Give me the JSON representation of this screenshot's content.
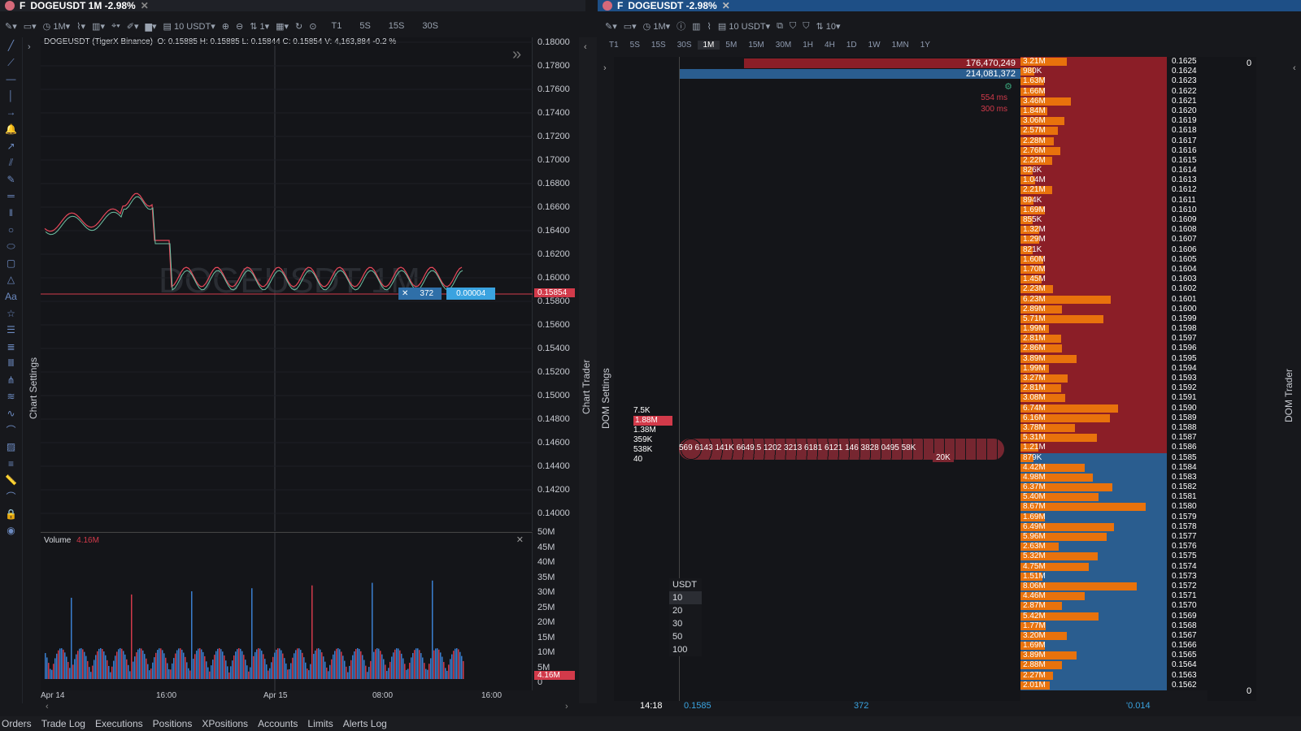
{
  "left_tab": {
    "title": "DOGEUSDT 1M -2.98%",
    "prefix": "F"
  },
  "right_tab": {
    "title": "DOGEUSDT -2.98%",
    "prefix": "F"
  },
  "chart_toolbar": {
    "interval": "1M",
    "size": "10 USDT",
    "tf": [
      "T1",
      "5S",
      "15S",
      "30S"
    ]
  },
  "chart_info": {
    "symbol": "DOGEUSDT (TigerX Binance)",
    "ohlc": "O: 0.15885 H: 0.15885 L: 0.15844 C: 0.15854 V: 4,163,884 -0.2 %"
  },
  "watermark": "DOGEUSDT 1M",
  "price_axis": [
    "0.18000",
    "0.17800",
    "0.17600",
    "0.17400",
    "0.17200",
    "0.17000",
    "0.16800",
    "0.16600",
    "0.16400",
    "0.16200",
    "0.16000",
    "0.15800",
    "0.15600",
    "0.15400",
    "0.15200",
    "0.15000",
    "0.14800",
    "0.14600",
    "0.14400",
    "0.14200",
    "0.14000"
  ],
  "last_price": "0.15854",
  "order_marker": {
    "qty": "372",
    "offset": "0.00004"
  },
  "volume_panel": {
    "title": "Volume",
    "value": "4.16M",
    "axis": [
      "50M",
      "45M",
      "40M",
      "35M",
      "30M",
      "25M",
      "20M",
      "15M",
      "10M",
      "5M",
      "0"
    ],
    "current": "4.16M"
  },
  "time_axis": [
    "Apr 14",
    "16:00",
    "Apr 15",
    "08:00",
    "16:00"
  ],
  "side_labels": {
    "chart_settings": "Chart Settings",
    "chart_trader": "Chart Trader",
    "dom_settings": "DOM Settings",
    "dom_trader": "DOM Trader"
  },
  "dom_toolbar": {
    "interval": "1M",
    "size": "10 USDT",
    "levels": "10"
  },
  "dom_timeframes": [
    "T1",
    "5S",
    "15S",
    "30S",
    "1M",
    "5M",
    "15M",
    "30M",
    "1H",
    "4H",
    "1D",
    "1W",
    "1MN",
    "1Y"
  ],
  "dom_totals": {
    "ask_total": "176,470,249",
    "bid_total": "214,081,372",
    "latency1": "554 ms",
    "latency2": "300 ms"
  },
  "dom_asks": [
    [
      "3.21M",
      "0.1625"
    ],
    [
      "980K",
      "0.1624"
    ],
    [
      "1.63M",
      "0.1623"
    ],
    [
      "1.66M",
      "0.1622"
    ],
    [
      "3.46M",
      "0.1621"
    ],
    [
      "1.84M",
      "0.1620"
    ],
    [
      "3.06M",
      "0.1619"
    ],
    [
      "2.57M",
      "0.1618"
    ],
    [
      "2.28M",
      "0.1617"
    ],
    [
      "2.76M",
      "0.1616"
    ],
    [
      "2.22M",
      "0.1615"
    ],
    [
      "826K",
      "0.1614"
    ],
    [
      "1.04M",
      "0.1613"
    ],
    [
      "2.21M",
      "0.1612"
    ],
    [
      "894K",
      "0.1611"
    ],
    [
      "1.69M",
      "0.1610"
    ],
    [
      "855K",
      "0.1609"
    ],
    [
      "1.32M",
      "0.1608"
    ],
    [
      "1.29M",
      "0.1607"
    ],
    [
      "821K",
      "0.1606"
    ],
    [
      "1.60M",
      "0.1605"
    ],
    [
      "1.70M",
      "0.1604"
    ],
    [
      "1.45M",
      "0.1603"
    ],
    [
      "2.23M",
      "0.1602"
    ],
    [
      "6.23M",
      "0.1601"
    ],
    [
      "2.89M",
      "0.1600"
    ],
    [
      "5.71M",
      "0.1599"
    ],
    [
      "1.99M",
      "0.1598"
    ],
    [
      "2.81M",
      "0.1597"
    ],
    [
      "2.86M",
      "0.1596"
    ],
    [
      "3.89M",
      "0.1595"
    ],
    [
      "1.99M",
      "0.1594"
    ],
    [
      "3.27M",
      "0.1593"
    ],
    [
      "2.81M",
      "0.1592"
    ],
    [
      "3.08M",
      "0.1591"
    ],
    [
      "6.74M",
      "0.1590"
    ],
    [
      "6.16M",
      "0.1589"
    ],
    [
      "3.78M",
      "0.1588"
    ],
    [
      "5.31M",
      "0.1587"
    ],
    [
      "1.21M",
      "0.1586"
    ]
  ],
  "dom_bids": [
    [
      "879K",
      "0.1585"
    ],
    [
      "4.42M",
      "0.1584"
    ],
    [
      "4.98M",
      "0.1583"
    ],
    [
      "6.37M",
      "0.1582"
    ],
    [
      "5.40M",
      "0.1581"
    ],
    [
      "8.67M",
      "0.1580"
    ],
    [
      "1.69M",
      "0.1579"
    ],
    [
      "6.49M",
      "0.1578"
    ],
    [
      "5.96M",
      "0.1577"
    ],
    [
      "2.63M",
      "0.1576"
    ],
    [
      "5.32M",
      "0.1575"
    ],
    [
      "4.75M",
      "0.1574"
    ],
    [
      "1.51M",
      "0.1573"
    ],
    [
      "8.06M",
      "0.1572"
    ],
    [
      "4.46M",
      "0.1571"
    ],
    [
      "2.87M",
      "0.1570"
    ],
    [
      "5.42M",
      "0.1569"
    ],
    [
      "1.77M",
      "0.1568"
    ],
    [
      "3.20M",
      "0.1567"
    ],
    [
      "1.69M",
      "0.1566"
    ],
    [
      "3.89M",
      "0.1565"
    ],
    [
      "2.88M",
      "0.1564"
    ],
    [
      "2.27M",
      "0.1563"
    ],
    [
      "2.01M",
      "0.1562"
    ]
  ],
  "dom_small_volumes": [
    "7.5K",
    "1.88M",
    "1.38M",
    "359K",
    "538K",
    "40"
  ],
  "dom_bubbles_text": "569 6143 141K 6649.5 1202 3213 6181 6121 146 3828 0495 58K",
  "dom_20k": "20K",
  "dom_quantity": {
    "header": "USDT",
    "options": [
      "10",
      "20",
      "30",
      "50",
      "100"
    ]
  },
  "dom_footer": {
    "time": "14:18",
    "price": "0.1585",
    "qty": "372",
    "delta": "'0.014"
  },
  "dom_zero_top": "0",
  "dom_zero_bottom": "0",
  "bottom_tabs": [
    "Orders",
    "Trade Log",
    "Executions",
    "Positions",
    "XPositions",
    "Accounts",
    "Limits",
    "Alerts Log"
  ]
}
